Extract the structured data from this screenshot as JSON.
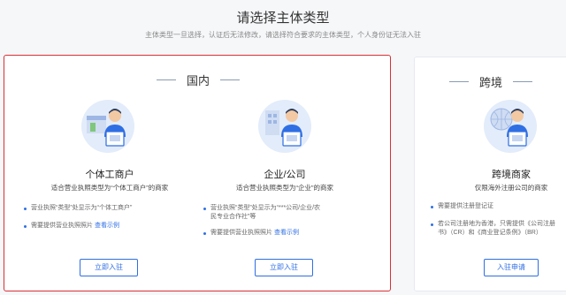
{
  "header": {
    "title": "请选择主体类型",
    "subtitle": "主体类型一旦选择，认证后无法修改，请选择符合要求的主体类型，个人身份证无法入驻"
  },
  "domestic": {
    "section_label": "国内",
    "individual": {
      "title": "个体工商户",
      "desc": "适合营业执照类型为“个体工商户”的商家",
      "bullets": [
        "营业执照“类型”处显示为“个体工商户”",
        "需要提供营业执照照片"
      ],
      "link": "查看示例",
      "button": "立即入驻",
      "icon": "storefront-person-icon"
    },
    "company": {
      "title": "企业/公司",
      "desc": "适合营业执照类型为“企业”的商家",
      "bullets": [
        "营业执照“类型”处显示为“***公司/企业/农",
        "民专业合作社”等",
        "需要提供营业执照照片"
      ],
      "link": "查看示例",
      "button": "立即入驻",
      "icon": "office-building-person-icon"
    }
  },
  "cross_border": {
    "section_label": "跨境",
    "merchant": {
      "title": "跨境商家",
      "desc": "仅限海外注册公司的商家",
      "bullets": [
        "需要提供注册登记证",
        "若公司注册地为香港，只需提供《公司注册",
        "书》（CR）和《商业登记条例》（BR）"
      ],
      "button": "入驻申请",
      "icon": "globe-person-icon"
    }
  },
  "colors": {
    "accent": "#2f6fe3",
    "highlight_border": "#d93035",
    "illustration_bg": "#e3ecfa"
  }
}
